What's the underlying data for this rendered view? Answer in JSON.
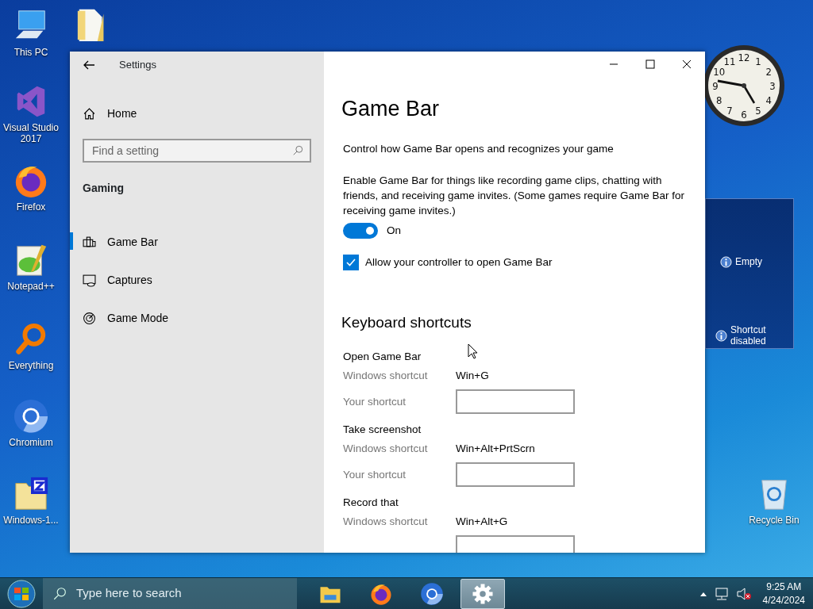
{
  "desktop_icons": [
    {
      "kind": "pc",
      "label": "This PC"
    },
    {
      "kind": "vs",
      "label": "Visual Studio 2017"
    },
    {
      "kind": "firefox",
      "label": "Firefox"
    },
    {
      "kind": "notepad",
      "label": "Notepad++"
    },
    {
      "kind": "everything",
      "label": "Everything"
    },
    {
      "kind": "chromium",
      "label": "Chromium"
    },
    {
      "kind": "zipfolder",
      "label": "Windows-1..."
    }
  ],
  "extra_icons": [
    {
      "kind": "folder"
    },
    {
      "kind": "recycle",
      "label": "Recycle Bin"
    }
  ],
  "clock": {
    "numerals": [
      "11",
      "12",
      "1",
      "10",
      "2",
      "9",
      "3",
      "8",
      "4",
      "7",
      "6",
      "5"
    ]
  },
  "gadget": {
    "items": [
      {
        "label": "Empty"
      },
      {
        "label": "Shortcut disabled"
      }
    ]
  },
  "window": {
    "title": "Settings",
    "sidebar": {
      "home": "Home",
      "search": {
        "placeholder": "Find a setting"
      },
      "section": "Gaming",
      "items": [
        {
          "kind": "gamebar",
          "label": "Game Bar",
          "selected": true
        },
        {
          "kind": "captures",
          "label": "Captures",
          "selected": false
        },
        {
          "kind": "gamemode",
          "label": "Game Mode",
          "selected": false
        }
      ]
    },
    "page": {
      "title": "Game Bar",
      "subtitle": "Control how Game Bar opens and recognizes your game",
      "description": "Enable Game Bar for things like recording game clips, chatting with friends, and receiving game invites. (Some games require Game Bar for receiving game invites.)",
      "toggle": {
        "on": true,
        "label": "On"
      },
      "checkbox": {
        "checked": true,
        "label": "Allow your controller to open Game Bar"
      },
      "shortcuts_title": "Keyboard shortcuts",
      "shortcuts": [
        {
          "name": "Open Game Bar",
          "windows_label": "Windows shortcut",
          "windows_shortcut": "Win+G",
          "your_label": "Your shortcut"
        },
        {
          "name": "Take screenshot",
          "windows_label": "Windows shortcut",
          "windows_shortcut": "Win+Alt+PrtScrn",
          "your_label": "Your shortcut"
        },
        {
          "name": "Record that",
          "windows_label": "Windows shortcut",
          "windows_shortcut": "Win+Alt+G"
        }
      ]
    }
  },
  "taskbar": {
    "search": {
      "placeholder": "Type here to search"
    },
    "apps": [
      {
        "kind": "explorer",
        "selected": false
      },
      {
        "kind": "firefox",
        "selected": false
      },
      {
        "kind": "chromium",
        "selected": false
      },
      {
        "kind": "settings",
        "selected": true
      }
    ],
    "time": "9:25 AM",
    "date": "4/24/2024"
  }
}
